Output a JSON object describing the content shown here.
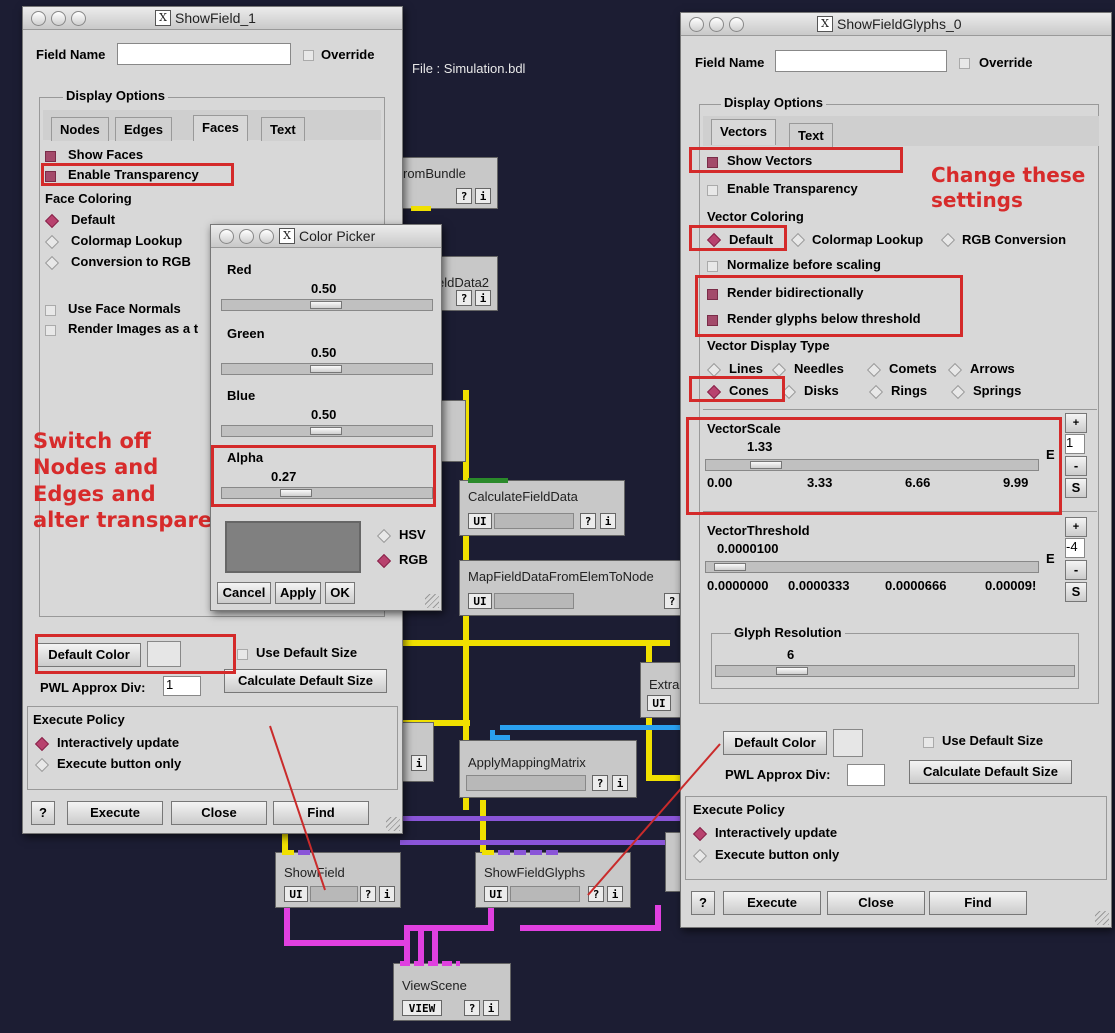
{
  "showfield_window": {
    "title": "ShowField_1",
    "field_name_label": "Field Name",
    "field_name_value": "",
    "override_label": "Override",
    "display_options_title": "Display Options",
    "tabs": [
      "Nodes",
      "Edges",
      "Faces",
      "Text"
    ],
    "active_tab": "Faces",
    "show_faces_label": "Show Faces",
    "enable_transparency_label": "Enable Transparency",
    "face_coloring_label": "Face Coloring",
    "coloring_options": [
      "Default",
      "Colormap Lookup",
      "Conversion to RGB"
    ],
    "use_face_normals_label": "Use Face Normals",
    "render_images_label": "Render Images as a t",
    "default_color_button": "Default Color",
    "use_default_size_label": "Use Default Size",
    "pwl_label": "PWL Approx Div:",
    "pwl_value": "1",
    "calc_default_size_button": "Calculate Default Size",
    "execute_policy_title": "Execute Policy",
    "policy_options": [
      "Interactively update",
      "Execute button only"
    ],
    "help_button": "?",
    "execute_button": "Execute",
    "close_button": "Close",
    "find_button": "Find"
  },
  "color_picker": {
    "title": "Color Picker",
    "red_label": "Red",
    "red_value": "0.50",
    "green_label": "Green",
    "green_value": "0.50",
    "blue_label": "Blue",
    "blue_value": "0.50",
    "alpha_label": "Alpha",
    "alpha_value": "0.27",
    "hsv_label": "HSV",
    "rgb_label": "RGB",
    "cancel_button": "Cancel",
    "apply_button": "Apply",
    "ok_button": "OK",
    "swatch_color": "#808080"
  },
  "glyphs_window": {
    "title": "ShowFieldGlyphs_0",
    "field_name_label": "Field Name",
    "field_name_value": "",
    "override_label": "Override",
    "display_options_title": "Display Options",
    "tabs": [
      "Vectors",
      "Text"
    ],
    "show_vectors_label": "Show Vectors",
    "enable_transparency_label": "Enable Transparency",
    "vector_coloring_label": "Vector Coloring",
    "coloring_options": [
      "Default",
      "Colormap Lookup",
      "RGB Conversion"
    ],
    "normalize_label": "Normalize before scaling",
    "render_bidir_label": "Render bidirectionally",
    "render_below_label": "Render glyphs below threshold",
    "display_type_label": "Vector Display Type",
    "display_types_row1": [
      "Lines",
      "Needles",
      "Comets",
      "Arrows"
    ],
    "display_types_row2": [
      "Cones",
      "Disks",
      "Rings",
      "Springs"
    ],
    "vector_scale_label": "VectorScale",
    "vector_scale_value": "1.33",
    "vector_scale_ticks": [
      "0.00",
      "3.33",
      "6.66",
      "9.99"
    ],
    "vector_scale_exp": "1",
    "vector_threshold_label": "VectorThreshold",
    "vector_threshold_value": "0.0000100",
    "vector_threshold_ticks": [
      "0.0000000",
      "0.0000333",
      "0.0000666",
      "0.00009!"
    ],
    "vector_threshold_exp": "-4",
    "e_label": "E",
    "plus": "+",
    "minus": "-",
    "s_label": "S",
    "glyph_resolution_title": "Glyph Resolution",
    "glyph_resolution_value": "6",
    "default_color_button": "Default Color",
    "use_default_size_label": "Use Default Size",
    "pwl_label": "PWL Approx Div:",
    "pwl_value": "",
    "calc_default_size_button": "Calculate Default Size",
    "execute_policy_title": "Execute Policy",
    "policy_options": [
      "Interactively update",
      "Execute button only"
    ],
    "help_button": "?",
    "execute_button": "Execute",
    "close_button": "Close",
    "find_button": "Find"
  },
  "annotations": {
    "left_note": [
      "Switch off",
      "Nodes and",
      "Edges and",
      "alter transparency"
    ],
    "right_note": [
      "Change these",
      "settings"
    ]
  },
  "canvas": {
    "file_label": "File : Simulation.bdl",
    "modules": {
      "fromBundle": "romBundle",
      "fieldData2": "eldData2",
      "calculate": "CalculateFieldData",
      "mapField": "MapFieldDataFromElemToNode",
      "extract": "Extra",
      "applyMapping": "ApplyMappingMatrix",
      "showField": "ShowField",
      "showGlyphs": "ShowFieldGlyphs",
      "viewScene": "ViewScene"
    },
    "ui_label": "UI",
    "view_label": "VIEW",
    "help_label": "?",
    "info_label": "i"
  }
}
